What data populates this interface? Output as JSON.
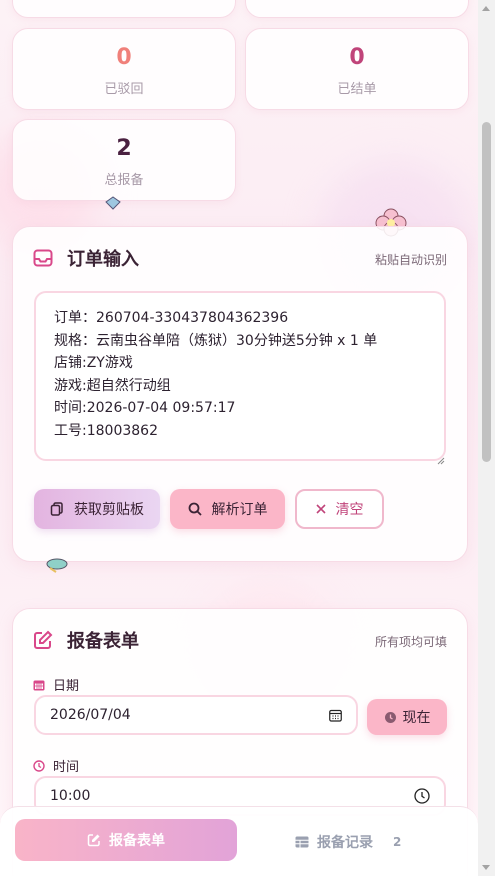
{
  "stats": {
    "rejected": {
      "value": "0",
      "label": "已驳回",
      "color": "#f0807a"
    },
    "settled": {
      "value": "0",
      "label": "已结单",
      "color": "#c0447a"
    },
    "total": {
      "value": "2",
      "label": "总报备",
      "color": "#4a2040"
    }
  },
  "order_input": {
    "title": "订单输入",
    "hint": "粘贴自动识别",
    "text": "订单：260704-330437804362396\n规格：云南虫谷单陪（炼狱）30分钟送5分钟  x 1 单\n店铺:ZY游戏\n游戏:超自然行动组\n时间:2026-07-04 09:57:17\n工号:18003862",
    "buttons": {
      "clipboard": "获取剪贴板",
      "parse": "解析订单",
      "clear": "清空"
    }
  },
  "report_form": {
    "title": "报备表单",
    "hint": "所有项均可填",
    "date_label": "日期",
    "date_value": "2026/07/04",
    "now_button": "现在",
    "time_label": "时间",
    "time_value": "10:00"
  },
  "bottom_nav": {
    "active_tab": "报备表单",
    "records_tab": "报备记录",
    "records_count": "2"
  },
  "colors": {
    "accent_pink": "#fbb6c8",
    "accent_purple": "#e2a3d8",
    "icon_pink": "#d9488a"
  }
}
